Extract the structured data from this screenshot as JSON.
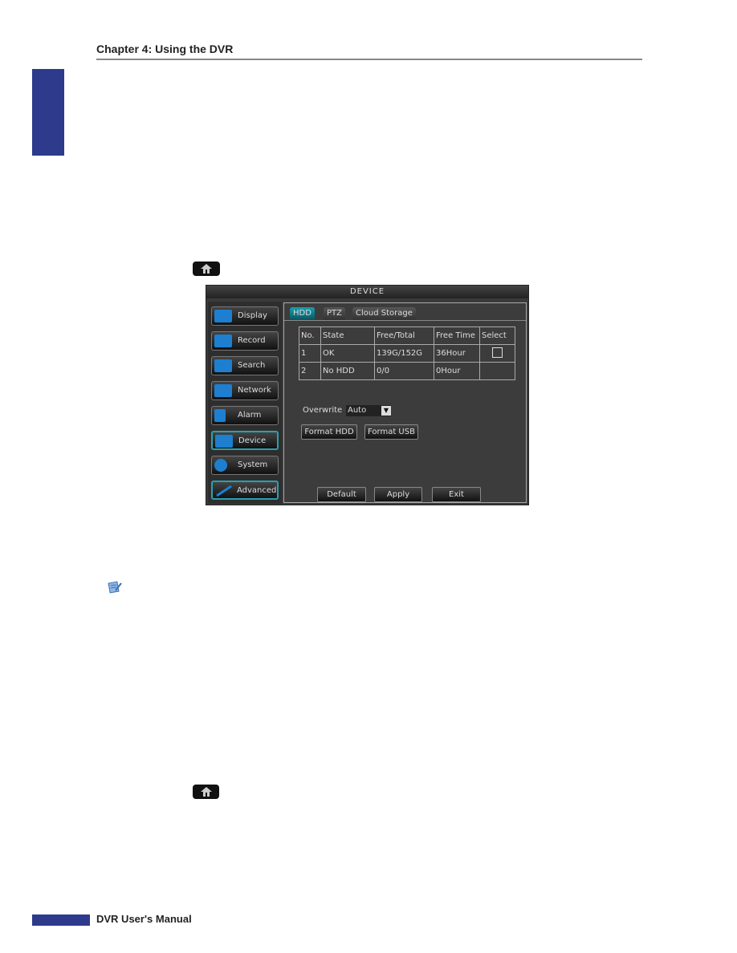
{
  "header": {
    "chapter": "Chapter 4: Using the DVR"
  },
  "footer": {
    "text": "DVR User's Manual"
  },
  "icons": {
    "home": "home-icon",
    "note": "note-icon"
  },
  "colors": {
    "brand": "#2e3a8c",
    "accent": "#1aa0b0"
  },
  "dvr": {
    "title": "DEVICE",
    "sidebar": [
      {
        "label": "Display"
      },
      {
        "label": "Record"
      },
      {
        "label": "Search"
      },
      {
        "label": "Network"
      },
      {
        "label": "Alarm"
      },
      {
        "label": "Device",
        "active": true
      },
      {
        "label": "System"
      },
      {
        "label": "Advanced"
      }
    ],
    "tabs": [
      {
        "label": "HDD",
        "active": true
      },
      {
        "label": "PTZ"
      },
      {
        "label": "Cloud Storage"
      }
    ],
    "table": {
      "headers": [
        "No.",
        "State",
        "Free/Total",
        "Free Time",
        "Select"
      ],
      "rows": [
        [
          "1",
          "OK",
          "139G/152G",
          "36Hour",
          ""
        ],
        [
          "2",
          "No HDD",
          "0/0",
          "0Hour",
          ""
        ]
      ]
    },
    "overwrite": {
      "label": "Overwrite",
      "value": "Auto"
    },
    "format_hdd": "Format HDD",
    "format_usb": "Format USB",
    "default": "Default",
    "apply": "Apply",
    "exit": "Exit"
  }
}
